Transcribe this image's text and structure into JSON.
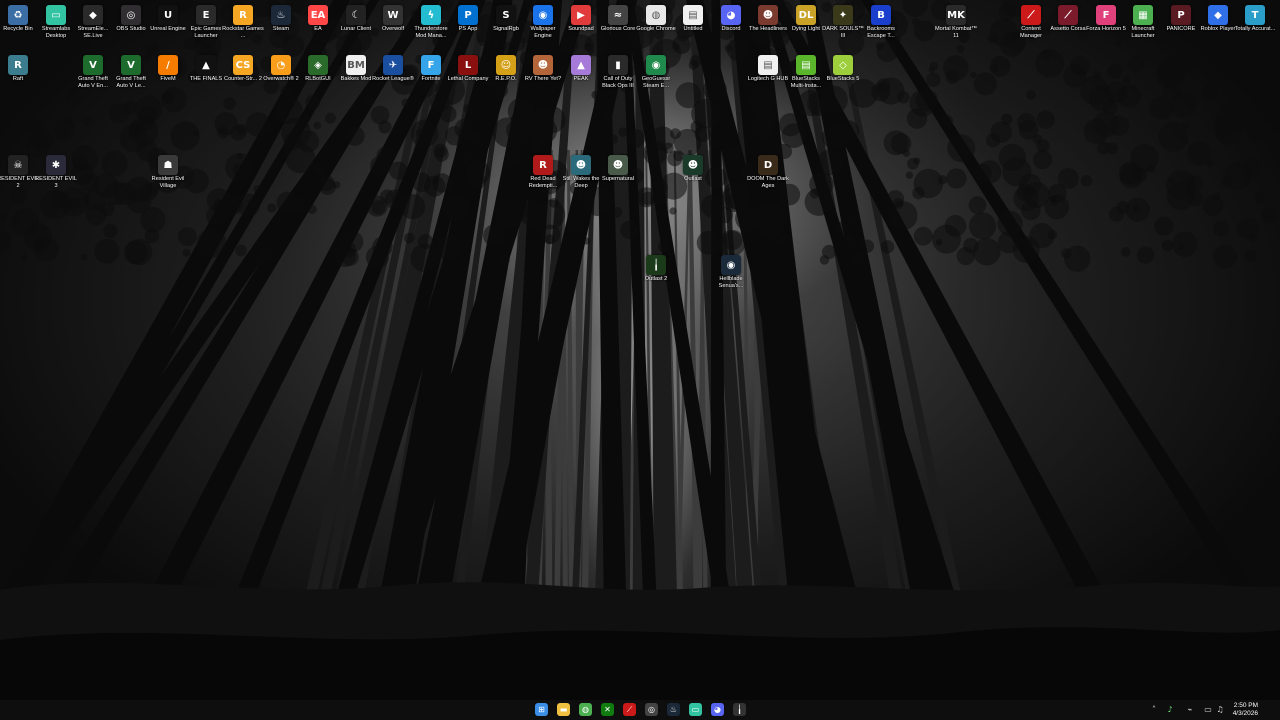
{
  "desktop": {
    "wallpaper": "dark foggy pine forest, grayscale",
    "icons": [
      {
        "label": "Recycle Bin",
        "icon": "recycle-bin-icon",
        "glyph": "♻",
        "color": "#3a6ea5"
      },
      {
        "label": "Streamlabs Desktop",
        "icon": "streamlabs-icon",
        "glyph": "▭",
        "color": "#31c3a2"
      },
      {
        "label": "StreamEle... SE.Live",
        "icon": "streamelements-icon",
        "glyph": "◆",
        "color": "#2a2a2a"
      },
      {
        "label": "OBS Studio",
        "icon": "obs-icon",
        "glyph": "◎",
        "color": "#302e31"
      },
      {
        "label": "Unreal Engine",
        "icon": "unreal-engine-icon",
        "glyph": "U",
        "color": "#111111"
      },
      {
        "label": "Epic Games Launcher",
        "icon": "epic-games-icon",
        "glyph": "E",
        "color": "#2a2a2a"
      },
      {
        "label": "Rockstar Games ...",
        "icon": "rockstar-icon",
        "glyph": "R",
        "color": "#f5a623"
      },
      {
        "label": "Steam",
        "icon": "steam-icon",
        "glyph": "♨",
        "color": "#1b2838"
      },
      {
        "label": "EA",
        "icon": "ea-icon",
        "glyph": "EA",
        "color": "#ff4747"
      },
      {
        "label": "Lunar Client",
        "icon": "lunar-client-icon",
        "glyph": "☾",
        "color": "#222222"
      },
      {
        "label": "Overwolf",
        "icon": "overwolf-icon",
        "glyph": "W",
        "color": "#333333"
      },
      {
        "label": "Thunderstore Mod Mana...",
        "icon": "thunderstore-icon",
        "glyph": "ϟ",
        "color": "#23bcd1"
      },
      {
        "label": "PS App",
        "icon": "playstation-icon",
        "glyph": "P",
        "color": "#0070d1"
      },
      {
        "label": "SignalRgb",
        "icon": "signalrgb-icon",
        "glyph": "S",
        "color": "#111111"
      },
      {
        "label": "Wallpaper Engine",
        "icon": "wallpaper-engine-icon",
        "glyph": "◉",
        "color": "#1a73e8"
      },
      {
        "label": "Soundpad",
        "icon": "soundpad-icon",
        "glyph": "▶",
        "color": "#e23b3b"
      },
      {
        "label": "Glorious Core",
        "icon": "glorious-core-icon",
        "glyph": "≈",
        "color": "#444444"
      },
      {
        "label": "Google Chrome",
        "icon": "chrome-icon",
        "glyph": "◍",
        "color": "#e8e8e8"
      },
      {
        "label": "Untitled",
        "icon": "document-icon",
        "glyph": "▤",
        "color": "#f0f0f0"
      },
      {
        "label": "Discord",
        "icon": "discord-icon",
        "glyph": "◕",
        "color": "#5865f2"
      },
      {
        "label": "The Headliners",
        "icon": "headliners-icon",
        "glyph": "☻",
        "color": "#7a3b2e"
      },
      {
        "label": "Dying Light",
        "icon": "dying-light-icon",
        "glyph": "DL",
        "color": "#c9a227"
      },
      {
        "label": "DARK SOULS™ III",
        "icon": "dark-souls-icon",
        "glyph": "✦",
        "color": "#3a3a1a"
      },
      {
        "label": "Backrooms Escape T...",
        "icon": "backrooms-icon",
        "glyph": "B",
        "color": "#1a3fcc"
      },
      {
        "label": "Mortal Kombat™ 11",
        "icon": "mortal-kombat-icon",
        "glyph": "MK",
        "color": "#2a2a2a"
      },
      {
        "label": "Content Manager",
        "icon": "content-manager-icon",
        "glyph": "⟋",
        "color": "#cc1a1a"
      },
      {
        "label": "Assetto Corsa",
        "icon": "assetto-corsa-icon",
        "glyph": "⟋",
        "color": "#7a1a2a"
      },
      {
        "label": "Forza Horizon 5",
        "icon": "forza-icon",
        "glyph": "F",
        "color": "#e0417a"
      },
      {
        "label": "Minecraft Launcher",
        "icon": "minecraft-icon",
        "glyph": "▦",
        "color": "#4caf50"
      },
      {
        "label": "PANICORE",
        "icon": "panicore-icon",
        "glyph": "P",
        "color": "#5a1a22"
      },
      {
        "label": "Roblox Player",
        "icon": "roblox-icon",
        "glyph": "◆",
        "color": "#2f6fe8"
      },
      {
        "label": "Totally Accurat...",
        "icon": "tabs-icon",
        "glyph": "T",
        "color": "#2a9dc8"
      },
      {
        "label": "Raft",
        "icon": "raft-icon",
        "glyph": "R",
        "color": "#3b7c8e"
      },
      {
        "label": "Grand Theft Auto V En...",
        "icon": "gta-v-icon",
        "glyph": "V",
        "color": "#1e6b2e"
      },
      {
        "label": "Grand Theft Auto V Le...",
        "icon": "gta-v-legacy-icon",
        "glyph": "V",
        "color": "#1e6b2e"
      },
      {
        "label": "FiveM",
        "icon": "fivem-icon",
        "glyph": "/",
        "color": "#f57c00"
      },
      {
        "label": "THE FINALS",
        "icon": "the-finals-icon",
        "glyph": "▲",
        "color": "#111111"
      },
      {
        "label": "Counter-Str... 2",
        "icon": "counter-strike-icon",
        "glyph": "CS",
        "color": "#f5a623"
      },
      {
        "label": "Overwatch® 2",
        "icon": "overwatch-icon",
        "glyph": "◔",
        "color": "#f99e1a"
      },
      {
        "label": "RLBotGUI",
        "icon": "rlbot-icon",
        "glyph": "◈",
        "color": "#2a6a2a"
      },
      {
        "label": "Bakkes Mod",
        "icon": "bakkesmod-icon",
        "glyph": "BM",
        "color": "#f0f0f0"
      },
      {
        "label": "Rocket League®",
        "icon": "rocket-league-icon",
        "glyph": "✈",
        "color": "#1a4fa0"
      },
      {
        "label": "Fortnite",
        "icon": "fortnite-icon",
        "glyph": "F",
        "color": "#36a4e8"
      },
      {
        "label": "Lethal Company",
        "icon": "lethal-company-icon",
        "glyph": "L",
        "color": "#8a0f0f"
      },
      {
        "label": "R.E.P.O.",
        "icon": "repo-icon",
        "glyph": "☺",
        "color": "#d4a017"
      },
      {
        "label": "RV There Yet?",
        "icon": "rv-there-yet-icon",
        "glyph": "☻",
        "color": "#b5653a"
      },
      {
        "label": "PEAK",
        "icon": "peak-icon",
        "glyph": "▲",
        "color": "#a67ad9"
      },
      {
        "label": "Call of Duty Black Ops III",
        "icon": "black-ops-icon",
        "glyph": "▮",
        "color": "#2a2a2a"
      },
      {
        "label": "GeoGuessr Steam E...",
        "icon": "geoguessr-icon",
        "glyph": "◉",
        "color": "#1f8a4c"
      },
      {
        "label": "Logitech G HUB",
        "icon": "document-icon",
        "glyph": "▤",
        "color": "#f0f0f0"
      },
      {
        "label": "BlueStacks Multi-Insta...",
        "icon": "bluestacks-multi-icon",
        "glyph": "▤",
        "color": "#5ab52a"
      },
      {
        "label": "BlueStacks 5",
        "icon": "bluestacks-icon",
        "glyph": "◇",
        "color": "#9ccf3b"
      },
      {
        "label": "RESIDENT EVIL 2",
        "icon": "resident-evil-2-icon",
        "glyph": "☠",
        "color": "#222222"
      },
      {
        "label": "RESIDENT EVIL 3",
        "icon": "resident-evil-3-icon",
        "glyph": "✱",
        "color": "#2a2a3a"
      },
      {
        "label": "Resident Evil Village",
        "icon": "resident-evil-village-icon",
        "glyph": "☗",
        "color": "#3a3a3a"
      },
      {
        "label": "Red Dead Redempti...",
        "icon": "red-dead-icon",
        "glyph": "R",
        "color": "#b01a1a"
      },
      {
        "label": "Still Wakes the Deep",
        "icon": "still-wakes-icon",
        "glyph": "☻",
        "color": "#2a6a7a"
      },
      {
        "label": "Supernatural",
        "icon": "supernatural-icon",
        "glyph": "☻",
        "color": "#4a5a4a"
      },
      {
        "label": "Outlast",
        "icon": "outlast-icon",
        "glyph": "☻",
        "color": "#1a3a2a"
      },
      {
        "label": "DOOM The Dark Ages",
        "icon": "doom-icon",
        "glyph": "D",
        "color": "#3a2a1a"
      },
      {
        "label": "Outlast 2",
        "icon": "outlast-2-icon",
        "glyph": "╽",
        "color": "#1a3a1a"
      },
      {
        "label": "Hellblade Senua's...",
        "icon": "hellblade-icon",
        "glyph": "◉",
        "color": "#1a2a3a"
      }
    ]
  },
  "taskbar": {
    "items": [
      {
        "name": "start-icon",
        "glyph": "⊞",
        "color": "#3a8ee6"
      },
      {
        "name": "file-explorer-icon",
        "glyph": "▬",
        "color": "#f0c040"
      },
      {
        "name": "chrome-taskbar-icon",
        "glyph": "◍",
        "color": "#4caf50"
      },
      {
        "name": "xbox-icon",
        "glyph": "✕",
        "color": "#107c10"
      },
      {
        "name": "content-manager-taskbar-icon",
        "glyph": "⟋",
        "color": "#cc1a1a"
      },
      {
        "name": "obs-taskbar-icon",
        "glyph": "◎",
        "color": "#444444"
      },
      {
        "name": "steam-taskbar-icon",
        "glyph": "♨",
        "color": "#1b2838"
      },
      {
        "name": "streamlabs-taskbar-icon",
        "glyph": "▭",
        "color": "#31c3a2"
      },
      {
        "name": "discord-taskbar-icon",
        "glyph": "◕",
        "color": "#5865f2"
      },
      {
        "name": "app-taskbar-icon",
        "glyph": "╽",
        "color": "#333333"
      }
    ],
    "tray": {
      "icons": [
        "chevron-up-icon",
        "microphone-icon",
        "network-icon",
        "monitor-icon",
        "volume-icon"
      ],
      "time": "2:50 PM",
      "date": "4/3/2026"
    }
  }
}
